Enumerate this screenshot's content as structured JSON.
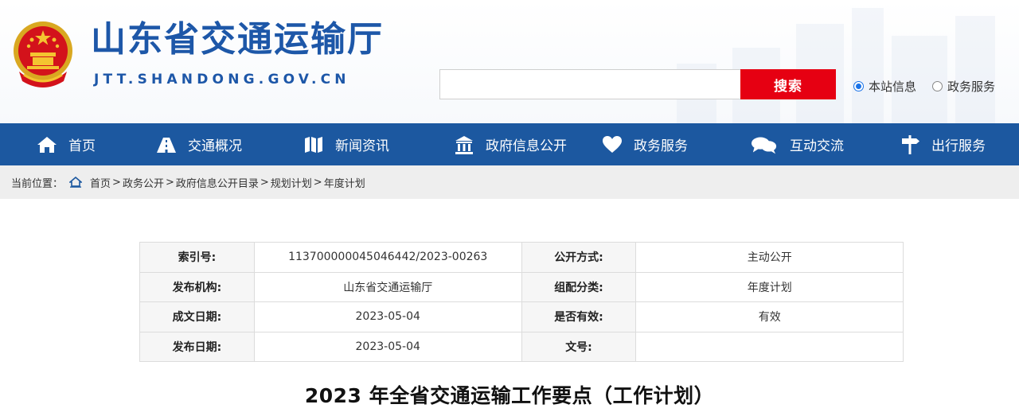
{
  "header": {
    "site_title": "山东省交通运输厅",
    "site_domain": "JTT.SHANDONG.GOV.CN",
    "emblem_icon": "national-emblem-icon"
  },
  "search": {
    "value": "",
    "placeholder": "",
    "button_label": "搜索",
    "scope_options": [
      {
        "label": "本站信息",
        "checked": true
      },
      {
        "label": "政务服务",
        "checked": false
      }
    ]
  },
  "nav": {
    "items": [
      {
        "label": "首页",
        "icon": "home-icon"
      },
      {
        "label": "交通概况",
        "icon": "road-icon"
      },
      {
        "label": "新闻资讯",
        "icon": "map-icon"
      },
      {
        "label": "政府信息公开",
        "icon": "government-building-icon"
      },
      {
        "label": "政务服务",
        "icon": "heart-icon"
      },
      {
        "label": "互动交流",
        "icon": "chat-bubbles-icon"
      },
      {
        "label": "出行服务",
        "icon": "signpost-icon"
      }
    ]
  },
  "breadcrumb": {
    "prefix": "当前位置：",
    "items": [
      "首页",
      "政务公开",
      "政府信息公开目录",
      "规划计划",
      "年度计划"
    ],
    "separator": ">"
  },
  "info_table": {
    "rows": [
      {
        "l1": "索引号:",
        "v1": "11370000004504644​2/2023-00263",
        "l2": "公开方式:",
        "v2": "主动公开"
      },
      {
        "l1": "发布机构:",
        "v1": "山东省交通运输厅",
        "l2": "组配分类:",
        "v2": "年度计划"
      },
      {
        "l1": "成文日期:",
        "v1": "2023-05-04",
        "l2": "是否有效:",
        "v2": "有效"
      },
      {
        "l1": "发布日期:",
        "v1": "2023-05-04",
        "l2": "文号:",
        "v2": ""
      }
    ]
  },
  "document": {
    "title": "2023 年全省交通运输工作要点（工作计划）"
  },
  "colors": {
    "brand_blue": "#1d57a8",
    "nav_blue": "#1c58a0",
    "search_red": "#e60012"
  }
}
